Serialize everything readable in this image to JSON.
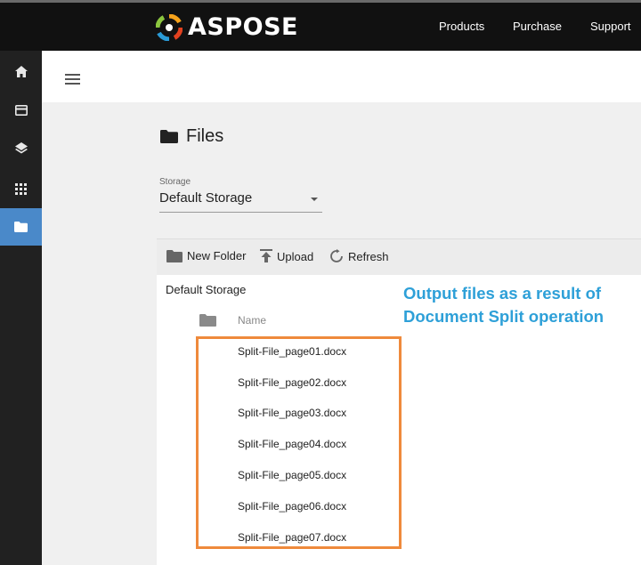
{
  "header": {
    "brand": "ASPOSE",
    "nav": [
      "Products",
      "Purchase",
      "Support"
    ]
  },
  "sidebar": {
    "items": [
      {
        "icon": "home-icon"
      },
      {
        "icon": "card-icon"
      },
      {
        "icon": "layers-icon"
      },
      {
        "icon": "apps-grid-icon"
      },
      {
        "icon": "folder-icon",
        "active": true
      }
    ]
  },
  "page": {
    "title": "Files",
    "storage_label": "Storage",
    "storage_value": "Default Storage"
  },
  "toolbar": {
    "new_folder": "New Folder",
    "upload": "Upload",
    "refresh": "Refresh"
  },
  "browser": {
    "breadcrumb": "Default Storage",
    "name_header": "Name",
    "files": [
      "Split-File_page01.docx",
      "Split-File_page02.docx",
      "Split-File_page03.docx",
      "Split-File_page04.docx",
      "Split-File_page05.docx",
      "Split-File_page06.docx",
      "Split-File_page07.docx"
    ]
  },
  "annotation": {
    "line1": "Output files as a result of",
    "line2": "Document Split operation",
    "text_color": "#2ea0d8",
    "box_color": "#ef8a3c"
  },
  "colors": {
    "topbar": "#111111",
    "sidebar": "#212121",
    "sidebar_active": "#4a89c9"
  }
}
